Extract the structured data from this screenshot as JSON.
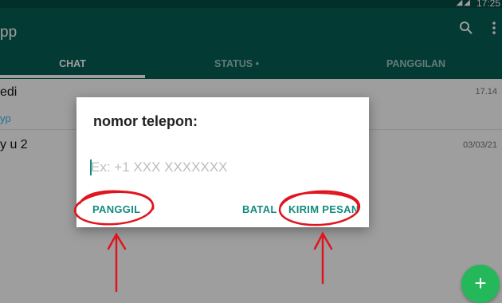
{
  "status_bar": {
    "time": "17:25",
    "icons": [
      "wifi-icon",
      "signal-icon"
    ]
  },
  "app_bar": {
    "title": "pp",
    "icons": [
      "search-icon",
      "more-vert-icon"
    ]
  },
  "tabs": [
    {
      "label": "CHAT",
      "active": true
    },
    {
      "label": "STATUS •",
      "active": false
    },
    {
      "label": "PANGGILAN",
      "active": false
    }
  ],
  "chats": [
    {
      "name": "edi",
      "preview": "yp",
      "time": "17.14"
    },
    {
      "name": "y u 2",
      "preview": "",
      "time": "03/03/21"
    }
  ],
  "dialog": {
    "title": "nomor telepon:",
    "input_value": "",
    "input_placeholder": "Ex: +1 XXX XXXXXXX",
    "buttons": {
      "call": "PANGGIL",
      "cancel": "BATAL",
      "send": "KIRIM PESAN"
    }
  },
  "fab": {
    "label": "+"
  },
  "colors": {
    "primary": "#075e54",
    "accent": "#128c7e",
    "fab": "#25b85b",
    "annotation": "#e0141e"
  }
}
